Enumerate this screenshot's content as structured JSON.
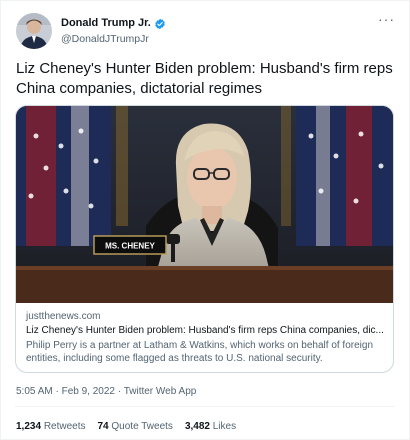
{
  "user": {
    "display_name": "Donald Trump Jr.",
    "handle": "@DonaldJTrumpJr",
    "verified": true
  },
  "more_icon": "···",
  "tweet": {
    "text": "Liz Cheney's Hunter Biden problem: Husband's firm reps China companies, dictatorial regimes"
  },
  "card": {
    "nameplate": "MS. CHENEY",
    "domain": "justthenews.com",
    "title": "Liz Cheney's Hunter Biden problem: Husband's firm reps China companies, dic...",
    "description": "Philip Perry is a partner at Latham & Watkins, which works on behalf of foreign entities, including some flagged as threats to U.S. national security."
  },
  "meta": {
    "time": "5:05 AM",
    "date": "Feb 9, 2022",
    "source": "Twitter Web App",
    "separator": " · "
  },
  "stats": {
    "retweets_count": "1,234",
    "retweets_label": "Retweets",
    "quotes_count": "74",
    "quotes_label": "Quote Tweets",
    "likes_count": "3,482",
    "likes_label": "Likes"
  },
  "colors": {
    "verified": "#1d9bf0",
    "secondary_text": "#536471",
    "primary_text": "#0f1419",
    "border": "#cfd9de"
  }
}
